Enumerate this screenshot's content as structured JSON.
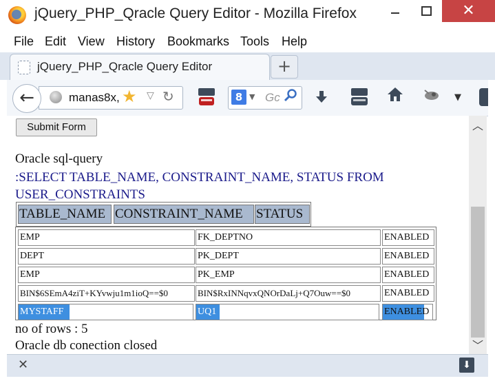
{
  "window": {
    "title": "jQuery_PHP_Qracle Query Editor - Mozilla Firefox",
    "close_glyph": "✕"
  },
  "menu": [
    "File",
    "Edit",
    "View",
    "History",
    "Bookmarks",
    "Tools",
    "Help"
  ],
  "tab": {
    "label": "jQuery_PHP_Qracle Query Editor",
    "new_tab_glyph": "+"
  },
  "navbar": {
    "back_glyph": "←",
    "url": "manas8x,",
    "search_placeholder": "Gc",
    "search_engine_glyph": "8"
  },
  "form": {
    "submit_label": "Submit Form"
  },
  "query": {
    "label": "Oracle sql-query",
    "text": ":SELECT TABLE_NAME, CONSTRAINT_NAME, STATUS FROM USER_CONSTRAINTS"
  },
  "table": {
    "headers": [
      "TABLE_NAME",
      "CONSTRAINT_NAME",
      "STATUS"
    ],
    "rows": [
      [
        "EMP",
        "FK_DEPTNO",
        "ENABLED"
      ],
      [
        "DEPT",
        "PK_DEPT",
        "ENABLED"
      ],
      [
        "EMP",
        "PK_EMP",
        "ENABLED"
      ],
      [
        "BIN$6SEmA4ziT+KYvwju1m1ioQ==$0",
        "BIN$RxINNqvxQNOrDaLj+Q7Ouw==$0",
        "ENABLED"
      ],
      [
        "MYSTAFF",
        "UQ1",
        "ENABLED"
      ]
    ],
    "selection_color": "#3e8fe0",
    "header_bg": "#a9b9cf"
  },
  "summary": {
    "row_count": "no of rows : 5",
    "connection": "Oracle db conection closed"
  },
  "colors": {
    "close_button": "#c74444",
    "query_text": "#1a1a8a"
  }
}
